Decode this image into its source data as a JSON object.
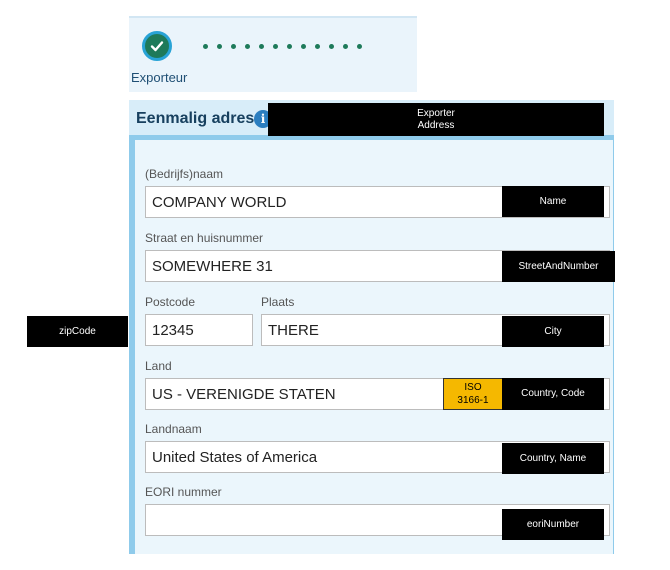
{
  "stepper": {
    "step_label": "Exporteur",
    "dot_count": 12
  },
  "panel": {
    "title": "Eenmalig adres",
    "info_icon": "i"
  },
  "fields": {
    "name": {
      "label": "(Bedrijfs)naam",
      "value": "COMPANY WORLD"
    },
    "street": {
      "label": "Straat en huisnummer",
      "value": "SOMEWHERE 31"
    },
    "postcode": {
      "label": "Postcode",
      "value": "12345"
    },
    "city": {
      "label": "Plaats",
      "value": "THERE"
    },
    "country": {
      "label": "Land",
      "value": "US - VERENIGDE STATEN"
    },
    "country_name": {
      "label": "Landnaam",
      "value": "United States of America"
    },
    "eori": {
      "label": "EORI nummer",
      "value": ""
    }
  },
  "annotations": {
    "exporter_address": "Exporter\nAddress",
    "name": "Name",
    "street": "StreetAndNumber",
    "zipcode": "zipCode",
    "city": "City",
    "iso": "ISO\n3166-1",
    "country_code": "Country, Code",
    "country_name": "Country, Name",
    "eori": "eoriNumber"
  },
  "colors": {
    "check_green": "#1e7a5a",
    "accent_blue": "#28a3d6",
    "iso_yellow": "#f5b800"
  }
}
